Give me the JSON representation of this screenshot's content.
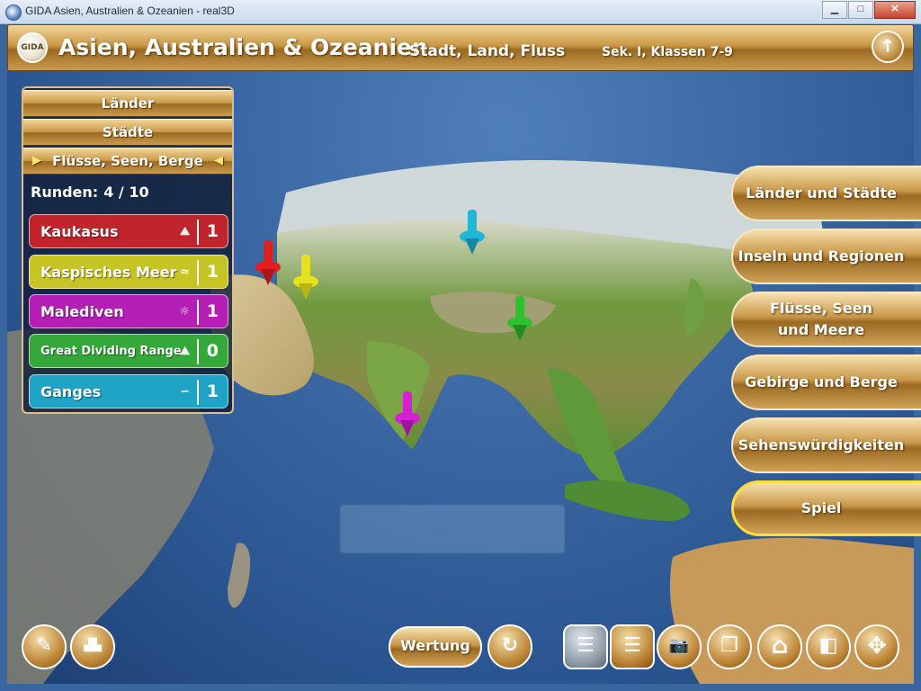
{
  "window": {
    "title": "GIDA Asien, Australien & Ozeanien - real3D",
    "minimize": "▁",
    "maximize": "□",
    "close": "✕"
  },
  "header": {
    "logo": "GIDA",
    "title": "Asien, Australien & Ozeanien",
    "subtitle": "Stadt, Land, Fluss",
    "grade": "Sek. I, Klassen 7-9",
    "up_icon": "↑"
  },
  "categories": [
    "Länder",
    "Städte",
    "Flüsse, Seen, Berge"
  ],
  "active_category": "Flüsse, Seen, Berge",
  "rounds": {
    "label": "Runden:",
    "value": "4 / 10"
  },
  "answers": [
    {
      "label": "Kaukasus",
      "count": "1",
      "color": "#c0242d",
      "icon": "mountain-icon"
    },
    {
      "label": "Kaspisches Meer",
      "count": "1",
      "color": "#c7c526",
      "icon": "lake-icon"
    },
    {
      "label": "Malediven",
      "count": "1",
      "color": "#b51fb5",
      "icon": "island-icon"
    },
    {
      "label": "Great Dividing Range",
      "count": "0",
      "color": "#35a83a",
      "icon": "mountain-icon"
    },
    {
      "label": "Ganges",
      "count": "1",
      "color": "#1fa4c6",
      "icon": "river-icon"
    }
  ],
  "side_menu": [
    {
      "label": "Länder und Städte"
    },
    {
      "label": "Inseln und Regionen"
    },
    {
      "label": "Flüsse, Seen\nund Meere"
    },
    {
      "label": "Gebirge und Berge"
    },
    {
      "label": "Sehenswürdigkeiten"
    },
    {
      "label": "Spiel"
    }
  ],
  "side_menu_active": "Spiel",
  "toolbar": {
    "wertung": "Wertung",
    "reload_icon": "↻",
    "camera_icon": "📷",
    "home_icon": "⌂",
    "move_icon": "✥"
  },
  "pin_colors": {
    "red": "#e02020",
    "yellow": "#e6e21e",
    "cyan": "#21b8d8",
    "green": "#2fc02f",
    "magenta": "#d61ed6"
  },
  "accent_gold": "#c9984a"
}
